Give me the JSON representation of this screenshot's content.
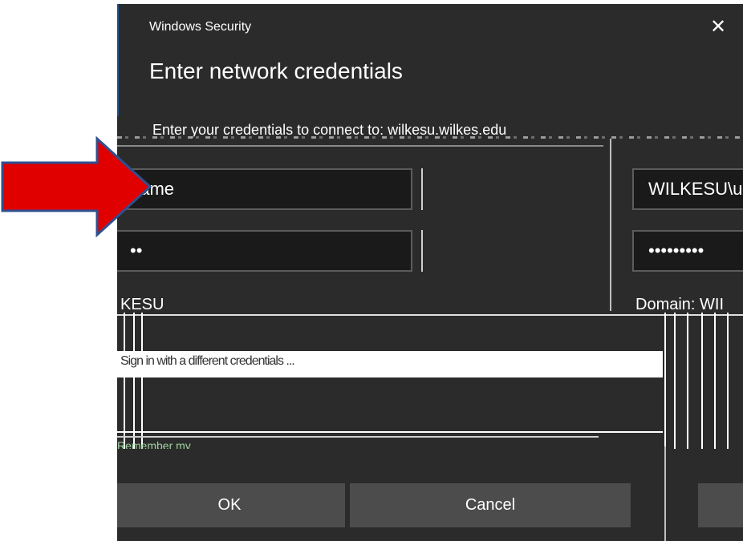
{
  "dialog": {
    "app_title": "Windows Security",
    "close_glyph": "✕",
    "heading": "Enter network credentials",
    "subtitle": "Enter your credentials to connect to: wilkesu.wilkes.edu"
  },
  "left_panel": {
    "username_value": "name",
    "password_value": "••",
    "domain_partial": "KESU"
  },
  "right_panel": {
    "username_value": "WILKESU\\us",
    "password_value": "•••••••••",
    "domain_partial": "Domain: WII"
  },
  "glitch": {
    "white_text": "Sign in with a different credentials ...",
    "green_text": "Remember my"
  },
  "buttons": {
    "ok_label": "OK",
    "cancel_label": "Cancel"
  },
  "colors": {
    "arrow_fill": "#e00000",
    "arrow_stroke": "#2f4f8f",
    "dialog_bg": "#2b2b2b"
  }
}
